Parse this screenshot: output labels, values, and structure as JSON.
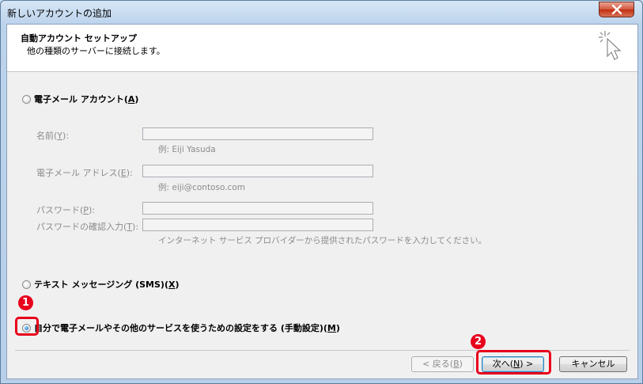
{
  "window": {
    "title": "新しいアカウントの追加"
  },
  "header": {
    "title": "自動アカウント セットアップ",
    "subtitle": "他の種類のサーバーに接続します。"
  },
  "options": {
    "email_account": {
      "label": "電子メール アカウント(",
      "key": "A",
      "suffix": ")"
    },
    "text_messaging": {
      "label": "テキスト メッセージング (SMS)(",
      "key": "X",
      "suffix": ")"
    },
    "manual": {
      "label": "自分で電子メールやその他のサービスを使うための設定をする (手動設定)(",
      "key": "M",
      "suffix": ")"
    }
  },
  "form": {
    "name": {
      "label": "名前(",
      "key": "Y",
      "suffix": "):",
      "hint": "例: Eiji Yasuda",
      "value": ""
    },
    "email": {
      "label": "電子メール アドレス(",
      "key": "E",
      "suffix": "):",
      "hint": "例: eiji@contoso.com",
      "value": ""
    },
    "password": {
      "label": "パスワード(",
      "key": "P",
      "suffix": "):",
      "value": ""
    },
    "password_confirm": {
      "label": "パスワードの確認入力(",
      "key": "T",
      "suffix": "):",
      "value": "",
      "hint": "インターネット サービス プロバイダーから提供されたパスワードを入力してください。"
    }
  },
  "buttons": {
    "back": {
      "label": "< 戻る(",
      "key": "B",
      "suffix": ")"
    },
    "next": {
      "label": "次へ(",
      "key": "N",
      "suffix": ") >"
    },
    "cancel": {
      "label": "キャンセル"
    }
  },
  "annotations": {
    "badge1": "1",
    "badge2": "2",
    "accent": "#e8001c"
  },
  "selected_option": "manual"
}
